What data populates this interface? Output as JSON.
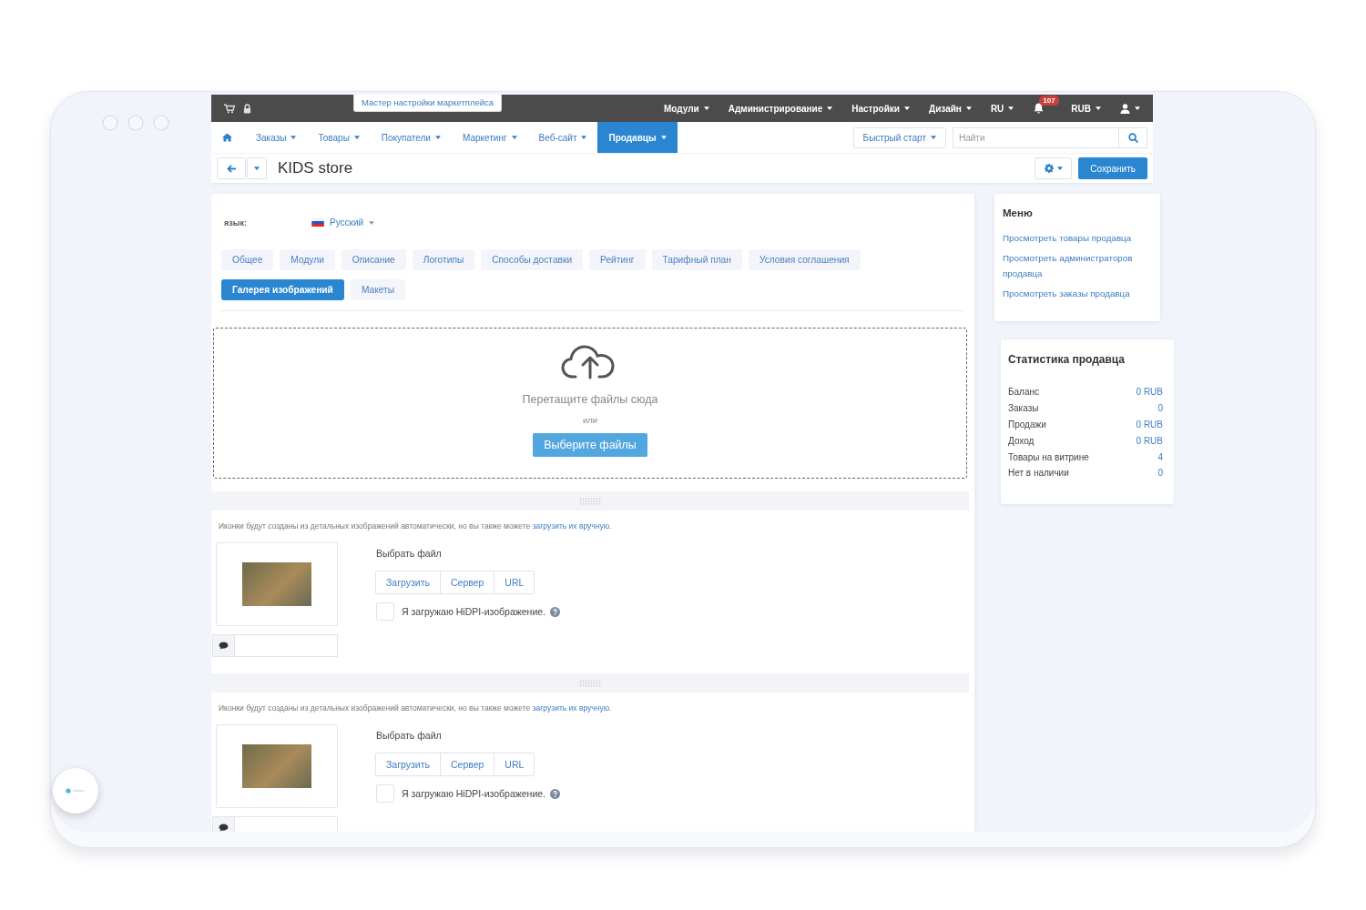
{
  "top_bar": {
    "wizard_link": "Мастер настройки маркетплейса",
    "menus": [
      {
        "kind": "dropdown",
        "label": "Модули"
      },
      {
        "kind": "dropdown",
        "label": "Администрирование"
      },
      {
        "kind": "dropdown",
        "label": "Настройки"
      },
      {
        "kind": "dropdown",
        "label": "Дизайн"
      },
      {
        "kind": "dropdown",
        "label": "RU"
      },
      {
        "kind": "notifications",
        "badge": "107"
      },
      {
        "kind": "dropdown",
        "label": "RUB"
      },
      {
        "kind": "user"
      }
    ]
  },
  "nav": {
    "items": [
      {
        "label": "Заказы",
        "selected": false
      },
      {
        "label": "Товары",
        "selected": false
      },
      {
        "label": "Покупатели",
        "selected": false
      },
      {
        "label": "Маркетинг",
        "selected": false
      },
      {
        "label": "Веб-сайт",
        "selected": false
      },
      {
        "label": "Продавцы",
        "selected": true
      }
    ],
    "quick_start": "Быстрый старт",
    "search": {
      "placeholder": "Найти"
    }
  },
  "page_header": {
    "title": "KIDS store",
    "save_button": "Сохранить"
  },
  "language": {
    "label": "язык:",
    "value": "Русский"
  },
  "tabs": [
    {
      "label": "Общее",
      "selected": false
    },
    {
      "label": "Модули",
      "selected": false
    },
    {
      "label": "Описание",
      "selected": false
    },
    {
      "label": "Логотипы",
      "selected": false
    },
    {
      "label": "Способы доставки",
      "selected": false
    },
    {
      "label": "Рейтинг",
      "selected": false
    },
    {
      "label": "Тарифный план",
      "selected": false
    },
    {
      "label": "Условия соглашения",
      "selected": false
    },
    {
      "label": "Галерея изображений",
      "selected": true
    },
    {
      "label": "Макеты",
      "selected": false
    }
  ],
  "dropzone": {
    "text": "Перетащите файлы сюда",
    "separator": "или",
    "button": "Выберите файлы"
  },
  "images": [
    {
      "hint": "Иконки будут созданы из детальных изображений автоматически, но вы также можете",
      "hint_link": "загрузить их вручную.",
      "file_label": "Выбрать файл",
      "sources": [
        "Загрузить",
        "Сервер",
        "URL"
      ],
      "hidpi": {
        "label": "Я загружаю HiDPI-изображение.",
        "checked": false
      }
    },
    {
      "hint": "Иконки будут созданы из детальных изображений автоматически, но вы также можете",
      "hint_link": "загрузить их вручную.",
      "file_label": "Выбрать файл",
      "sources": [
        "Загрузить",
        "Сервер",
        "URL"
      ],
      "hidpi": {
        "label": "Я загружаю HiDPI-изображение.",
        "checked": false
      }
    }
  ],
  "sidebar": {
    "menu": {
      "title": "Меню",
      "links": [
        "Просмотреть товары продавца",
        "Просмотреть администраторов продавца",
        "Просмотреть заказы продавца"
      ]
    },
    "stats": {
      "title": "Статистика продавца",
      "rows": [
        {
          "label": "Баланс",
          "value": "0 RUB"
        },
        {
          "label": "Заказы",
          "value": "0"
        },
        {
          "label": "Продажи",
          "value": "0 RUB"
        },
        {
          "label": "Доход",
          "value": "0 RUB"
        },
        {
          "label": "Товары на витрине",
          "value": "4"
        },
        {
          "label": "Нет в наличии",
          "value": "0"
        }
      ]
    }
  }
}
